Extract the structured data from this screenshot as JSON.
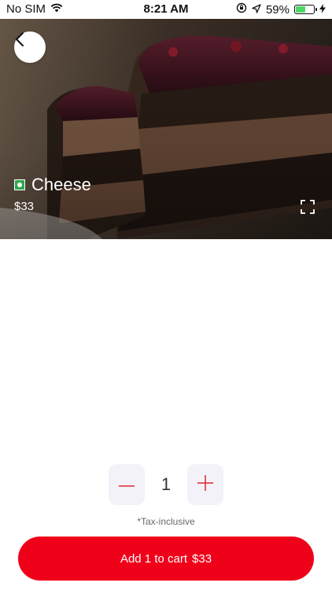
{
  "status_bar": {
    "carrier": "No SIM",
    "time": "8:21 AM",
    "battery_percent": "59%",
    "battery_level": 0.59,
    "icons": [
      "wifi-icon",
      "orientation-lock-icon",
      "location-icon",
      "battery-icon",
      "charging-icon"
    ]
  },
  "product": {
    "name": "Cheese",
    "price": "$33",
    "veg_indicator_color": "#2fa84f"
  },
  "stepper": {
    "quantity": "1",
    "minus_icon": "minus-icon",
    "plus_icon": "plus-icon"
  },
  "tax_note": "*Tax-inclusive",
  "cart_button": {
    "label": "Add 1 to cart",
    "price": "$33",
    "color": "#f0011a"
  },
  "colors": {
    "accent": "#f0011a",
    "stepper_bg": "#f3f2f8"
  }
}
